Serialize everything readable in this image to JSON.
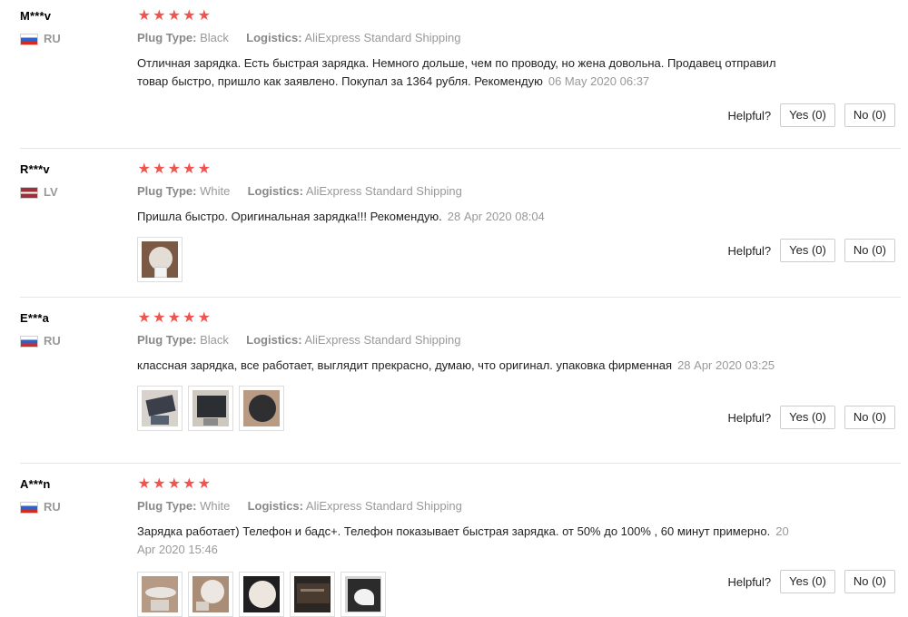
{
  "reviews": [
    {
      "user": "M***v",
      "country": "RU",
      "stars": 5,
      "plug_label": "Plug Type:",
      "plug_value": "Black",
      "logistics_label": "Logistics:",
      "logistics_value": "AliExpress Standard Shipping",
      "text": "Отличная зарядка. Есть быстрая зарядка. Немного дольше, чем по проводу, но жена довольна. Продавец отправил товар быстро, пришло как заявлено. Покупал за 1364 рубля. Рекомендую",
      "date": "06 May 2020 06:37",
      "photo_count": 0
    },
    {
      "user": "R***v",
      "country": "LV",
      "stars": 5,
      "plug_label": "Plug Type:",
      "plug_value": "White",
      "logistics_label": "Logistics:",
      "logistics_value": "AliExpress Standard Shipping",
      "text": "Пришла быстро. Оригинальная зарядка!!! Рекомендую.",
      "date": "28 Apr 2020 08:04",
      "photo_count": 1
    },
    {
      "user": "E***a",
      "country": "RU",
      "stars": 5,
      "plug_label": "Plug Type:",
      "plug_value": "Black",
      "logistics_label": "Logistics:",
      "logistics_value": "AliExpress Standard Shipping",
      "text": "классная зарядка, все работает, выглядит прекрасно, думаю, что оригинал. упаковка фирменная",
      "date": "28 Apr 2020 03:25",
      "photo_count": 3
    },
    {
      "user": "A***n",
      "country": "RU",
      "stars": 5,
      "plug_label": "Plug Type:",
      "plug_value": "White",
      "logistics_label": "Logistics:",
      "logistics_value": "AliExpress Standard Shipping",
      "text": "Зарядка работает) Телефон и бадс+. Телефон показывает быстрая зарядка. от 50% до 100% , 60 минут примерно.",
      "date": "20 Apr 2020 15:46",
      "photo_count": 5
    }
  ],
  "helpful": {
    "label": "Helpful?",
    "yes_label": "Yes (0)",
    "no_label": "No (0)"
  },
  "colors": {
    "star": "#f0544f",
    "muted": "#999999",
    "separator": "#e5e5e5"
  },
  "icons": {
    "star": "star-icon",
    "flag_ru": "flag-ru-icon",
    "flag_lv": "flag-lv-icon"
  }
}
